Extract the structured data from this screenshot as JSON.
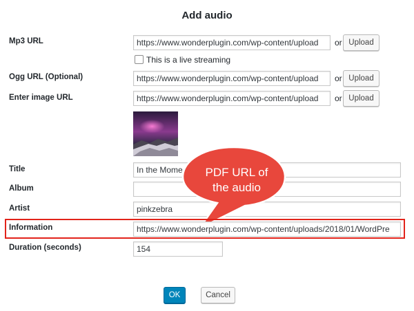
{
  "dialog": {
    "title": "Add audio"
  },
  "mp3": {
    "label": "Mp3 URL",
    "value": "https://www.wonderplugin.com/wp-content/upload",
    "or": "or",
    "upload_label": "Upload",
    "live_label": "This is a live streaming"
  },
  "ogg": {
    "label": "Ogg URL (Optional)",
    "value": "https://www.wonderplugin.com/wp-content/upload",
    "or": "or",
    "upload_label": "Upload"
  },
  "image": {
    "label": "Enter image URL",
    "value": "https://www.wonderplugin.com/wp-content/upload",
    "or": "or",
    "upload_label": "Upload"
  },
  "fields": {
    "title_label": "Title",
    "title_value": "In the Mome",
    "album_label": "Album",
    "album_value": "",
    "artist_label": "Artist",
    "artist_value": "pinkzebra",
    "info_label": "Information",
    "info_value": "https://www.wonderplugin.com/wp-content/uploads/2018/01/WordPre",
    "duration_label": "Duration (seconds)",
    "duration_value": "154"
  },
  "callout": {
    "line1": "PDF URL of",
    "line2": "the audio",
    "color": "#e8473c"
  },
  "buttons": {
    "ok": "OK",
    "cancel": "Cancel"
  },
  "colors": {
    "primary": "#0085ba",
    "highlight": "#e2231a"
  }
}
